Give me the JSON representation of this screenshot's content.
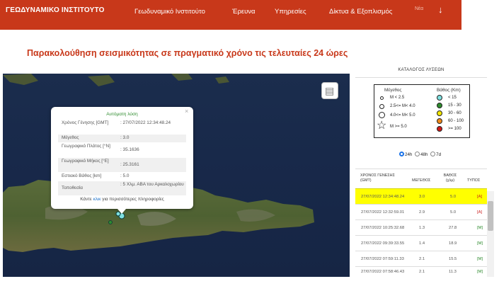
{
  "nav": {
    "logo": "ΓΕΩΔΥΝΑΜΙΚΟ ΙΝΣΤΙΤΟΥΤΟ",
    "links": [
      "Γεωδυναμικό Ινστιτούτο",
      "Έρευνα",
      "Υπηρεσίες",
      "Δίκτυα & Εξοπλισμός"
    ],
    "lang": "Νέα",
    "down_icon": "arrow-down-icon"
  },
  "page_title": "Παρακολούθηση σεισμικότητας σε πραγματικό χρόνο τις τελευταίες 24 ώρες",
  "popup": {
    "title": "Αυτόματη λύση",
    "rows": [
      {
        "label": "Χρόνος Γένησης [GMT]",
        "value": ": 27/07/2022 12:34:48.24"
      },
      {
        "label": "Μέγεθος",
        "value": ": 3.0"
      },
      {
        "label": "Γεωγραφικό Πλάτος [°N]",
        "value": ": 35.1636"
      },
      {
        "label": "Γεωγραφικό Μήκος [°E]",
        "value": ": 25.3161"
      },
      {
        "label": "Εστιακό Βάθος [km]",
        "value": ": 5.0"
      },
      {
        "label": "Τοποθεσία",
        "value": ": 5 Χλμ. ΑΒΑ του Αρκαλοχωρίου"
      }
    ],
    "more_prefix": "Κάντε",
    "more_link": "κλικ",
    "more_suffix": "για περισσότερες πληροφορίες",
    "close": "×"
  },
  "catalog": {
    "title": "ΚΑΤΑΛΟΓΟΣ ΛΥΣΕΩΝ",
    "legend": {
      "mag_header": "Μέγεθος",
      "depth_header": "Βάθος (Km)",
      "mag_items": [
        "M < 2.5",
        "2.5<= M< 4.0",
        "4.0<= M< 5.0",
        "M >= 5.0"
      ],
      "depth_items": [
        {
          "label": "< 15",
          "color": "#7fe0e0"
        },
        {
          "label": "15 - 30",
          "color": "#2e8b2e"
        },
        {
          "label": "30 - 60",
          "color": "#f2e600"
        },
        {
          "label": "60 - 100",
          "color": "#f08a1a"
        },
        {
          "label": ">= 100",
          "color": "#d01a1a"
        }
      ]
    },
    "ranges": [
      "24h",
      "48h",
      "7d"
    ],
    "selected_range": "24h",
    "headers": {
      "time": "ΧΡΟΝΟΣ ΓΕΝΕΣΗΣ (GMT)",
      "mag": "ΜΕΓΕΘΟΣ",
      "depth": "ΒΑΘΟΣ (χλμ)",
      "type": "ΤΥΠΟΣ"
    },
    "rows": [
      {
        "time": "27/07/2022 12:34:48.24",
        "mag": "3.0",
        "depth": "5.0",
        "type": "[A]"
      },
      {
        "time": "27/07/2022 12:32:59.01",
        "mag": "2.9",
        "depth": "5.0",
        "type": "[A]"
      },
      {
        "time": "27/07/2022 10:25:32.68",
        "mag": "1.3",
        "depth": "27.8",
        "type": "[M]"
      },
      {
        "time": "27/07/2022 09:39:33.55",
        "mag": "1.4",
        "depth": "18.9",
        "type": "[M]"
      },
      {
        "time": "27/07/2022 07:59:11.33",
        "mag": "2.1",
        "depth": "15.5",
        "type": "[M]"
      },
      {
        "time": "27/07/2022 07:58:46.43",
        "mag": "2.1",
        "depth": "11.3",
        "type": "[M]"
      }
    ]
  },
  "map": {
    "layers_icon": "layers-icon"
  }
}
